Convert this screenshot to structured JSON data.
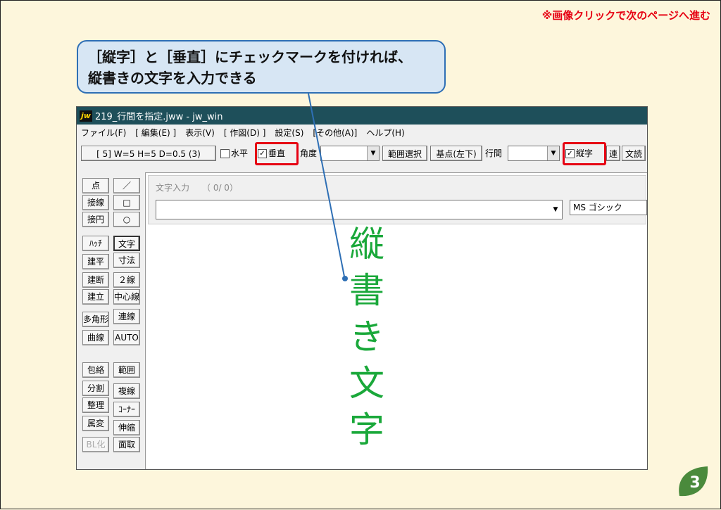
{
  "nav_note": "※画像クリックで次のページへ進む",
  "callout": {
    "line1": "［縦字］と［垂直］にチェックマークを付ければ、",
    "line2": "縦書きの文字を入力できる"
  },
  "window": {
    "logo": "jw",
    "title": "219_行間を指定.jww - jw_win"
  },
  "menu": [
    "ファイル(F)",
    "[ 編集(E) ]",
    "表示(V)",
    "[ 作図(D) ]",
    "設定(S)",
    "[その他(A)]",
    "ヘルプ(H)"
  ],
  "toolbar": {
    "size_button": "[ 5]  W=5  H=5  D=0.5 (3)",
    "horizontal_label": "水平",
    "vertical_label": "垂直",
    "check_mark": "✓",
    "angle_label": "角度",
    "range_select": "範囲選択",
    "base_point": "基点(左下)",
    "line_spacing_label": "行間",
    "vertical_text_label": "縦字",
    "continuous": "連",
    "text_read": "文読"
  },
  "tools": [
    [
      "点",
      "／"
    ],
    [
      "接線",
      "□"
    ],
    [
      "接円",
      "○"
    ],
    [
      "ﾊｯﾁ",
      "文字"
    ],
    [
      "建平",
      "寸法"
    ],
    [
      "建断",
      "２線"
    ],
    [
      "建立",
      "中心線"
    ],
    [
      "多角形",
      "連線"
    ],
    [
      "曲線",
      "AUTO"
    ],
    [
      "包絡",
      "範囲"
    ],
    [
      "分割",
      "複線"
    ],
    [
      "整理",
      "ｺｰﾅｰ"
    ],
    [
      "属変",
      "伸縮"
    ],
    [
      "BL化",
      "面取"
    ]
  ],
  "text_input": {
    "label": "文字入力　　（ 0/  0）",
    "value": "",
    "font": "MS ゴシック"
  },
  "vertical_text": [
    "縦",
    "書",
    "き",
    "文",
    "字"
  ],
  "page_number": "3",
  "colors": {
    "accent_red": "#e60012",
    "text_green": "#1aa83a",
    "badge_green": "#4a8a3c",
    "callout_blue": "#2e6fb5"
  }
}
